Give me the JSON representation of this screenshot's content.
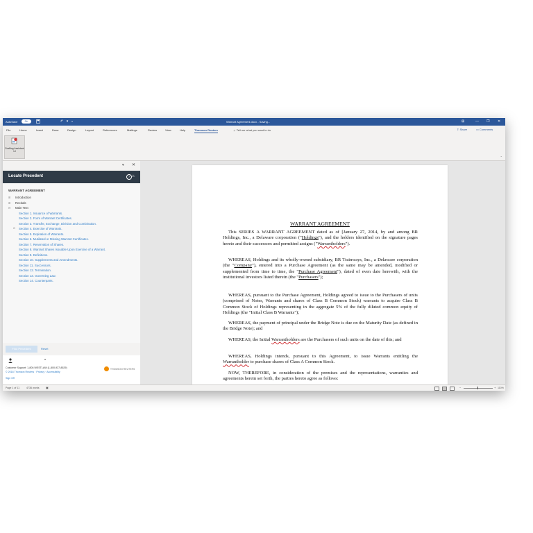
{
  "titlebar": {
    "autosave_label": "AutoSave",
    "autosave_state": "On",
    "document_title": "Warrant Agreement.docx - Saving...",
    "window_controls": [
      "—",
      "❐",
      "✕"
    ],
    "ribbon_display": "⊞"
  },
  "ribbon": {
    "tabs": [
      "File",
      "Home",
      "Insert",
      "Draw",
      "Design",
      "Layout",
      "References",
      "Mailings",
      "Review",
      "View",
      "Help",
      "Thomson Reuters"
    ],
    "active_tab": "Thomson Reuters",
    "tell_me": "Tell me what you want to do",
    "share": "Share",
    "comments": "Comments",
    "drafting_button": "Drafting Assistant UI",
    "collapse": "⌃"
  },
  "pane": {
    "dropdown": "▾",
    "close": "✕",
    "title": "Locate Precedent",
    "help": "?",
    "home": "⌂",
    "doc_heading": "WARRANT AGREEMENT",
    "top_items": [
      "Introduction",
      "Recitals",
      "Main Text"
    ],
    "sections": [
      "Section 1. Issuance of Warrants.",
      "Section 2. Form of Warrant Certificates.",
      "Section 3. Transfer, Exchange, Division and Combination.",
      "Section 4. Exercise of Warrants.",
      "Section 5. Expiration of Warrants.",
      "Section 6. Mutilated or Missing Warrant Certificates.",
      "Section 7. Reservation of Shares.",
      "Section 8. Warrant Shares Issuable Upon Exercise of a Warrant.",
      "Section 9. Definitions.",
      "Section 10. Supplements and Amendments.",
      "Section 11. Successors.",
      "Section 12. Termination.",
      "Section 13. Governing Law.",
      "Section 14. Counterparts."
    ],
    "find_button": "Find Precedent",
    "reset_button": "Reset",
    "user_caret": "▾",
    "support": "Customer Support: 1-800-WESTLAW (1-800-937-8529)",
    "copyright": "© 2018 Thomson Reuters  ·  Privacy  ·  Accessibility",
    "logo_text": "THOMSON REUTERS",
    "sign_off": "Sign Off"
  },
  "document": {
    "heading": "WARRANT AGREEMENT",
    "p1": {
      "a": "This SERIES A WARRANT AGREEMENT dated as of [January 27, 2014, by and among BR Holdings, Inc., a Delaware corporation (\"",
      "holdings": "Holdings",
      "b": "\"), and the holders identified on the signature pages hereto and their successors and permitted assigns (\"",
      "warrantholders": "Warrantholders",
      "c": "\")."
    },
    "p2": {
      "a": "WHEREAS, Holdings and its wholly-owned subsidiary, BR Trainways, Inc., a Delaware corporation (the \"",
      "company": "Company",
      "b": "\"), entered into a Purchase Agreement (as the same may be amended, modified or supplemented from time to time, the \"",
      "pa": "Purchase Agreement",
      "c": "\"), dated of even date herewith, with the institutional investors listed therein (the \"",
      "purchasers": "Purchasers",
      "d": "\");"
    },
    "p3": "WHEREAS, pursuant to the Purchase Agreement, Holdings agreed to issue to the Purchasers of units (comprised of Notes, Warrants and shares of Class B Common Stock) warrants to acquire Class B Common Stock of Holdings representing in the aggregate 5% of the fully diluted common equity of Holdings (the \"Initial Class B Warrants\");",
    "p4": "WHEREAS, the payment of principal under the Bridge Note is due on the Maturity Date (as defined in the Bridge Note); and",
    "p5": {
      "a": "WHEREAS, the Initial ",
      "w": "Warrantholders",
      "b": " are the Purchasers of such units on the date of this; and"
    },
    "p6": {
      "a": "WHEREAS, Holdings intends, pursuant to this Agreement, to issue Warrants entitling the ",
      "w": "Warrantholder",
      "b": " to purchase shares of Class A Common Stock."
    },
    "p7": "NOW, THEREFORE, in consideration of the premises and the representations, warranties and agreements herein set forth, the parties hereto agree as follows:"
  },
  "status": {
    "page": "Page 1 of 11",
    "words": "4736 words",
    "zoom_minus": "−",
    "zoom_plus": "+",
    "zoom": "110%"
  }
}
